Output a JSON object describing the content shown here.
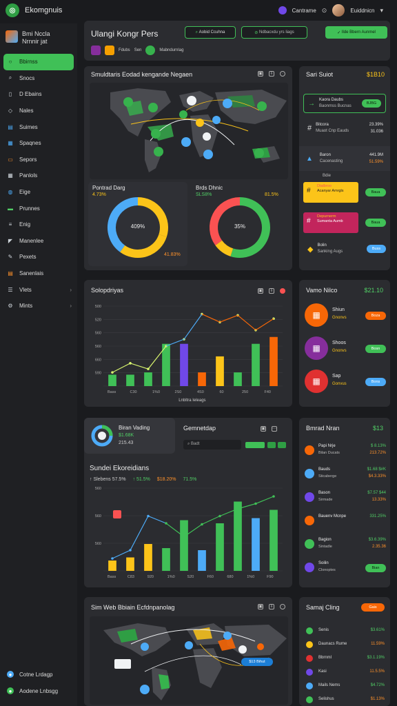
{
  "topbar": {
    "brand": "Ekomgnuis",
    "user_label": "Cantrame",
    "user_name": "Euiddnicn"
  },
  "sidebar": {
    "header": [
      "Bmi Nccla",
      "Nrnnir jat"
    ],
    "items": [
      {
        "label": "Bbirnss",
        "icon": "circle-icon",
        "color": "#40c057"
      },
      {
        "label": "Snocs",
        "icon": "search-icon",
        "color": "#ced4da"
      },
      {
        "label": "D Ebains",
        "icon": "document-icon",
        "color": "#ced4da"
      },
      {
        "label": "Nales",
        "icon": "tag-icon",
        "color": "#ced4da"
      },
      {
        "label": "Suimes",
        "icon": "chart-icon",
        "color": "#4dabf7"
      },
      {
        "label": "Spaqnes",
        "icon": "grid-icon",
        "color": "#4dabf7"
      },
      {
        "label": "Sepors",
        "icon": "folder-icon",
        "color": "#ff922b"
      },
      {
        "label": "Panlols",
        "icon": "table-icon",
        "color": "#ced4da"
      },
      {
        "label": "Eige",
        "icon": "globe-icon",
        "color": "#4dabf7"
      },
      {
        "label": "Prunnes",
        "icon": "image-icon",
        "color": "#51cf66"
      },
      {
        "label": "Enig",
        "icon": "bars-icon",
        "color": "#ced4da"
      },
      {
        "label": "Manenlee",
        "icon": "send-icon",
        "color": "#ced4da"
      },
      {
        "label": "Pexets",
        "icon": "edit-icon",
        "color": "#ced4da"
      },
      {
        "label": "Sanenlais",
        "icon": "calendar-icon",
        "color": "#ff922b"
      },
      {
        "label": "Vlets",
        "icon": "list-icon",
        "color": "#ced4da"
      },
      {
        "label": "Mints",
        "icon": "settings-icon",
        "color": "#ced4da"
      }
    ],
    "footer": [
      "Cotne Lrdagp",
      "Aodene Lnbsgg"
    ]
  },
  "header": {
    "title": "Ulangi Kongr Pers",
    "btn1": "Aobid Ccuhna",
    "btn2": "Ndbacxdu yrs liags",
    "btn3": "Ilde Bbern Aunmel",
    "tags": [
      "Fdubs",
      "Sen",
      "Mabndurnlag"
    ]
  },
  "map1": {
    "title": "Smuldtaris Eodad kengande Negaen"
  },
  "donuts": {
    "left_title": "Pontrad Darg",
    "left_value": "4.73%",
    "left_center": "409%",
    "left_foot": "41.83%",
    "right_title": "Brds Dhnic",
    "right_value": "SLS8%",
    "right_sub": "81.5%",
    "right_center": "35%",
    "left_split": [
      0.3,
      0.3,
      0.4
    ],
    "right_split": [
      0.55,
      0.1,
      0.35
    ]
  },
  "sidebox1": {
    "title": "Sari Suiot",
    "value": "$1B10",
    "rows": [
      {
        "label": "Kaora Daubs",
        "sub": "Baonmss Bucnas",
        "badge": "BJBG"
      },
      {
        "label": "Bitcora",
        "sub": "Muaot Cnp Eauds",
        "v1": "23.39%",
        "v2": "31.036"
      },
      {
        "label": "Baron",
        "sub": "Cacenasting",
        "v1": "441.9M",
        "v2": "51.59%"
      },
      {
        "label": "Bdie",
        "sub": ""
      },
      {
        "label": "Dtalbroo",
        "sub": "Acanyar Amrgls",
        "badge": "Baua"
      },
      {
        "label": "Depurnerm",
        "sub": "Sumanta Aumb",
        "badge": "Baua"
      },
      {
        "label": "Bolin",
        "sub": "Sanking Augs",
        "badge": "Buss"
      }
    ]
  },
  "chart1": {
    "title": "Solopdriyas"
  },
  "sidebox2": {
    "title": "Vamo Nilco",
    "value": "$21.10",
    "rows": [
      {
        "label": "Shiun",
        "sub": "Gnonvs",
        "badge": "Boza"
      },
      {
        "label": "Shoos",
        "sub": "Gnonvs",
        "badge": "Bosn"
      },
      {
        "label": "Sap",
        "sub": "Gonvus",
        "badge": "Bons"
      }
    ]
  },
  "card_mini": {
    "title": "Biran Vading",
    "v1": "$1.68K",
    "v2": "215.43"
  },
  "chart2": {
    "title": "Sundei Ekoreidians",
    "head": "Gemnetdap",
    "search": "Badt",
    "legend": [
      {
        "label": "Slebens",
        "val": "57.5%",
        "color": "#51cf66"
      },
      {
        "label": "51.5%",
        "val": "",
        "color": "#51cf66"
      },
      {
        "label": "$18.20%",
        "val": "",
        "color": "#ff922b"
      },
      {
        "label": "71.5%",
        "val": "",
        "color": "#51cf66"
      }
    ]
  },
  "sidebox3": {
    "title": "Bmrad Nran",
    "value": "$13",
    "rows": [
      {
        "label": "Papi Nrje",
        "sub": "Bilan Ducats",
        "v1": "$ 8.13%",
        "v2": "213.72%"
      },
      {
        "label": "Bauds",
        "sub": "Sticaberge",
        "v1": "$1.68 $#K",
        "v2": "$4.3.33%"
      },
      {
        "label": "Bason",
        "sub": "Sirmade",
        "v1": "$7.57 $44",
        "v2": "13.33%"
      },
      {
        "label": "Bauenv Mcnpe",
        "sub": "",
        "v1": "331.25%",
        "v2": ""
      },
      {
        "label": "Bagion",
        "sub": "Sintadle",
        "v1": "$3.6.39%",
        "v2": "2.35.36"
      },
      {
        "label": "Soilin",
        "sub": "Clonoptes",
        "badge": "Bian"
      }
    ]
  },
  "map2": {
    "title": "Sim Web Bbiain Ecfdnpanolag",
    "chip": "$13 Bihut"
  },
  "sidebox4": {
    "title": "Samaj Cling",
    "badge": "Gais",
    "rows": [
      {
        "label": "Senis",
        "v": "$3.61%"
      },
      {
        "label": "Daunacs Rume",
        "v": "11.59%"
      },
      {
        "label": "Bbrnml",
        "v": "$3.1.19%"
      },
      {
        "label": "Kasi",
        "v": "11.5.5%"
      },
      {
        "label": "Mails Nems",
        "v": "$4.72%"
      },
      {
        "label": "Selishus",
        "v": "$1.13%"
      }
    ]
  },
  "chart_data": [
    {
      "type": "bar",
      "title": "Solopdriyas",
      "categories": [
        "1",
        "2",
        "3",
        "4",
        "5",
        "6",
        "7",
        "8",
        "9",
        "10"
      ],
      "series": [
        {
          "values": [
            1,
            1,
            1.2,
            3.7,
            3.7,
            1.2,
            2.6,
            1.2,
            3.7,
            4.3
          ]
        }
      ],
      "line": [
        1.2,
        2,
        1.5,
        3.5,
        4.1,
        6.3,
        5.6,
        6.2,
        4.9,
        5.9
      ],
      "ylim": [
        0,
        7
      ],
      "yticks": [
        "",
        "590",
        "660",
        "560",
        "560",
        "520",
        "500"
      ],
      "xticks": [
        "Bass",
        "C30",
        "1%0",
        "2S0",
        "4S0",
        "60",
        "250",
        "F40"
      ],
      "xlabel": "Lnbltra Ieleags"
    },
    {
      "type": "bar",
      "title": "Sundei Ekoreidians",
      "categories": [
        "1",
        "2",
        "3",
        "4",
        "5",
        "6",
        "7",
        "8",
        "9",
        "10"
      ],
      "series": [
        {
          "values": [
            1,
            1.3,
            2.6,
            2.2,
            4.9,
            2,
            4.6,
            6.7,
            5.1,
            5.9
          ]
        }
      ],
      "line": [
        1.2,
        2,
        5.3,
        4.6,
        3.3,
        4.5,
        5.3,
        6,
        6.5,
        7.2
      ],
      "ylim": [
        0,
        8
      ],
      "yticks": [
        "",
        "560",
        "560",
        "560"
      ],
      "xticks": [
        "Bass",
        "C83",
        "920",
        "1%0",
        "S20",
        "F60",
        "680",
        "1%0",
        "F90"
      ]
    }
  ]
}
